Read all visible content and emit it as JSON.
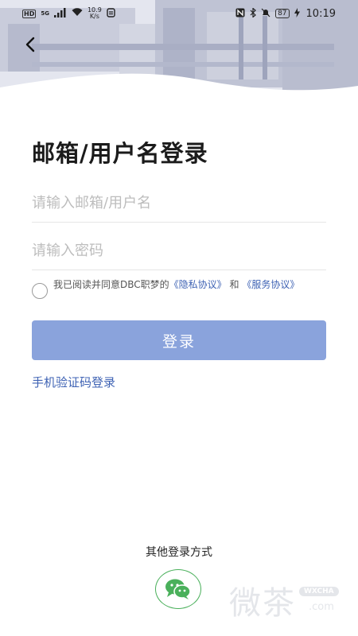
{
  "status_bar": {
    "hd": "HD",
    "network": "5G",
    "speed_value": "10.9",
    "speed_unit": "K/s",
    "battery": "87",
    "time": "10:19"
  },
  "header": {
    "title": "邮箱/用户名登录"
  },
  "form": {
    "account_placeholder": "请输入邮箱/用户名",
    "password_placeholder": "请输入密码",
    "agreement_prefix": "我已阅读并同意DBC职梦的",
    "privacy_link": "《隐私协议》",
    "agreement_and": " 和 ",
    "service_link": "《服务协议》",
    "login_button": "登录",
    "sms_login": "手机验证码登录"
  },
  "other_login": {
    "title": "其他登录方式",
    "wechat_icon": "wechat-icon"
  },
  "watermark": {
    "text": "微茶",
    "badge": "WXCHA",
    "domain": ".com"
  },
  "colors": {
    "accent": "#3f63b4",
    "login_button_bg": "#8aa3dc",
    "wechat_green": "#4ab05b"
  }
}
